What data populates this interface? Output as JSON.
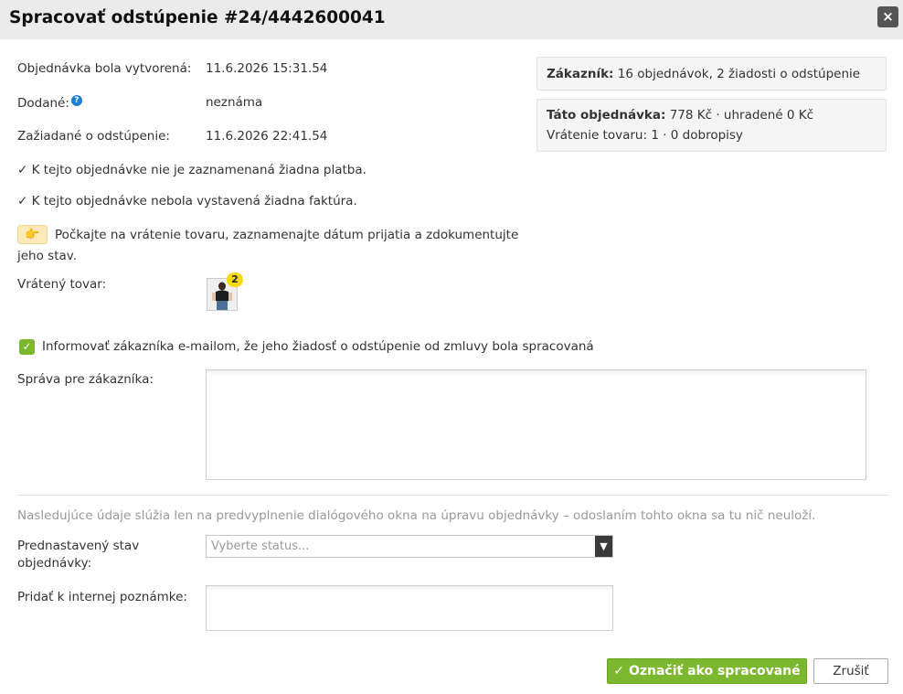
{
  "dialog": {
    "title": "Spracovať odstúpenie #24/4442600041",
    "close_label": "×"
  },
  "details": {
    "created_label": "Objednávka bola vytvorená:",
    "created_value": "11.6.2026 15:31.54",
    "delivered_label": "Dodané:",
    "delivered_help": "?",
    "delivered_value": "neznáma",
    "requested_label": "Zažiadané o odstúpenie:",
    "requested_value": "11.6.2026 22:41.54",
    "payment_status": "✓ K tejto objednávke nie je zaznamenaná žiadna platba.",
    "invoice_status": "✓ K tejto objednávke nebola vystavená žiadna faktúra.",
    "notice": "Počkajte na vrátenie tovaru, zaznamenajte dátum prijatia a zdokumentujte jeho stav.",
    "returned_label": "Vrátený tovar:",
    "returned_count": "2"
  },
  "sidebar": {
    "customer_label": "Zákazník:",
    "customer_value": "16 objednávok, 2 žiadosti o odstúpenie",
    "order_label": "Táto objednávka:",
    "order_value": "778 Kč · uhradené 0 Kč",
    "returns_value": "Vrátenie tovaru: 1 · 0 dobropisy"
  },
  "notify": {
    "checked": true,
    "label": "Informovať zákazníka e-mailom, že jeho žiadosť o odstúpenie od zmluvy bola spracovaná"
  },
  "message": {
    "label": "Správa pre zákazníka:",
    "value": ""
  },
  "prefill": {
    "hint": "Nasledujúce údaje slúžia len na predvyplnenie dialógového okna na úpravu objednávky – odoslaním tohto okna sa tu nič neuloží.",
    "status_label": "Prednastavený stav objednávky:",
    "status_placeholder": "Vyberte status...",
    "note_label": "Pridať k internej poznámke:",
    "note_value": ""
  },
  "actions": {
    "primary_label": "✓ Označiť ako spracované",
    "cancel_label": "Zrušiť"
  },
  "colors": {
    "accent": "#7cb82f",
    "help": "#1a7fd4",
    "badge": "#f5d90a"
  }
}
